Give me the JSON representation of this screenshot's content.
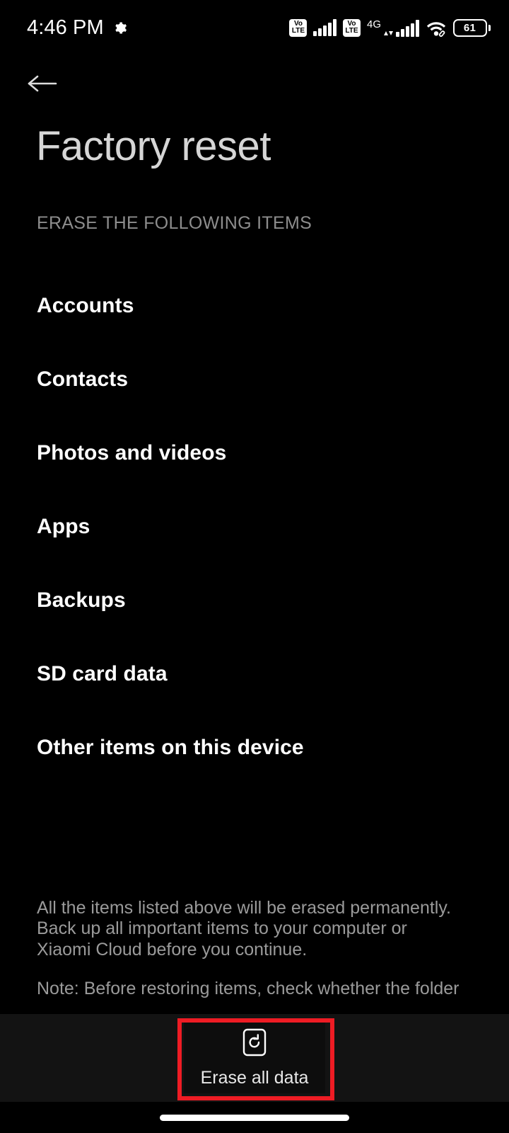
{
  "status_bar": {
    "time": "4:46 PM",
    "gear_icon": "gear-icon",
    "sim1_volte_top": "Vo",
    "sim1_volte_bottom": "LTE",
    "sim2_volte_top": "Vo",
    "sim2_volte_bottom": "LTE",
    "network_type": "4G",
    "wifi_icon": "wifi-linked-icon",
    "battery_level": "61"
  },
  "header": {
    "back_icon": "back-arrow-icon",
    "title": "Factory reset"
  },
  "section": {
    "label": "ERASE THE FOLLOWING ITEMS",
    "items": [
      {
        "label": "Accounts"
      },
      {
        "label": "Contacts"
      },
      {
        "label": "Photos and videos"
      },
      {
        "label": "Apps"
      },
      {
        "label": "Backups"
      },
      {
        "label": "SD card data"
      },
      {
        "label": "Other items on this device"
      }
    ]
  },
  "footer": {
    "paragraph1": "All the items listed above will be erased permanently. Back up all important items to your computer or Xiaomi Cloud before you continue.",
    "paragraph2": "Note: Before restoring items, check whether the folder"
  },
  "bottom_bar": {
    "erase_icon": "factory-reset-icon",
    "erase_label": "Erase all data"
  },
  "annotation": {
    "highlight_color": "#ee1c24"
  },
  "nav_bar": {
    "gesture_pill": "home-gesture-pill"
  },
  "colors": {
    "background": "#000000",
    "title_text": "#d6d6d6",
    "item_text": "#ffffff",
    "muted_text": "#9a9a9a",
    "bottom_bar_bg": "#131313"
  }
}
